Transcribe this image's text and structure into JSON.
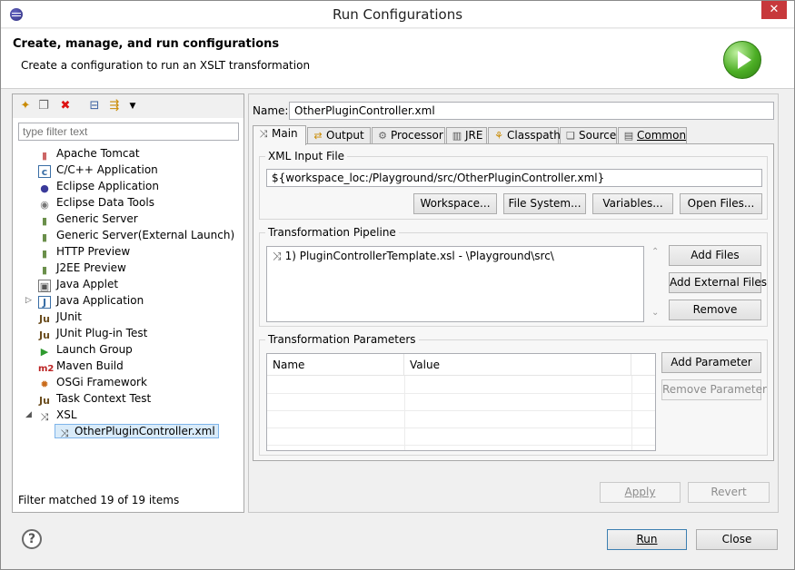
{
  "window": {
    "title": "Run Configurations",
    "close_glyph": "✕"
  },
  "header": {
    "title": "Create, manage, and run configurations",
    "subtitle": "Create a configuration to run an XSLT transformation"
  },
  "left": {
    "filter_placeholder": "type filter text",
    "toolbar_icons": [
      "new-config-icon",
      "duplicate-icon",
      "delete-icon",
      "collapse-all-icon",
      "filter-icon"
    ],
    "tree": [
      {
        "label": "Apache Tomcat",
        "icon": "tomcat-icon"
      },
      {
        "label": "C/C++ Application",
        "icon": "c-icon"
      },
      {
        "label": "Eclipse Application",
        "icon": "eclipse-icon"
      },
      {
        "label": "Eclipse Data Tools",
        "icon": "database-icon"
      },
      {
        "label": "Generic Server",
        "icon": "server-icon"
      },
      {
        "label": "Generic Server(External Launch)",
        "icon": "server-icon"
      },
      {
        "label": "HTTP Preview",
        "icon": "server-icon"
      },
      {
        "label": "J2EE Preview",
        "icon": "server-icon"
      },
      {
        "label": "Java Applet",
        "icon": "applet-icon"
      },
      {
        "label": "Java Application",
        "icon": "java-icon"
      },
      {
        "label": "JUnit",
        "icon": "junit-icon"
      },
      {
        "label": "JUnit Plug-in Test",
        "icon": "junit-plugin-icon"
      },
      {
        "label": "Launch Group",
        "icon": "launch-group-icon"
      },
      {
        "label": "Maven Build",
        "icon": "maven-icon"
      },
      {
        "label": "OSGi Framework",
        "icon": "osgi-icon"
      },
      {
        "label": "Task Context Test",
        "icon": "task-test-icon"
      },
      {
        "label": "XSL",
        "icon": "xsl-icon"
      },
      {
        "label": "OtherPluginController.xml",
        "icon": "xsl-icon"
      }
    ],
    "status": "Filter matched 19 of 19 items"
  },
  "right": {
    "name_label": "Name:",
    "name_value": "OtherPluginController.xml",
    "tabs": [
      {
        "label": "Main",
        "icon": "main-tab-icon"
      },
      {
        "label": "Output",
        "icon": "output-tab-icon"
      },
      {
        "label": "Processor",
        "icon": "processor-tab-icon"
      },
      {
        "label": "JRE",
        "icon": "jre-tab-icon"
      },
      {
        "label": "Classpath",
        "icon": "classpath-tab-icon"
      },
      {
        "label": "Source",
        "icon": "source-tab-icon"
      },
      {
        "label": "Common",
        "icon": "common-tab-icon"
      }
    ],
    "xml_input": {
      "title": "XML Input File",
      "value": "${workspace_loc:/Playground/src/OtherPluginController.xml}",
      "buttons": [
        "Workspace...",
        "File System...",
        "Variables...",
        "Open Files..."
      ]
    },
    "pipeline": {
      "title": "Transformation Pipeline",
      "items": [
        "1) PluginControllerTemplate.xsl - \\Playground\\src\\"
      ],
      "buttons": [
        "Add Files",
        "Add External Files",
        "Remove"
      ]
    },
    "parameters": {
      "title": "Transformation Parameters",
      "columns": [
        "Name",
        "Value"
      ],
      "buttons": [
        "Add Parameter",
        "Remove Parameter"
      ]
    },
    "apply_label": "Apply",
    "revert_label": "Revert"
  },
  "footer": {
    "run_label": "Run",
    "close_label": "Close",
    "help_glyph": "?"
  }
}
